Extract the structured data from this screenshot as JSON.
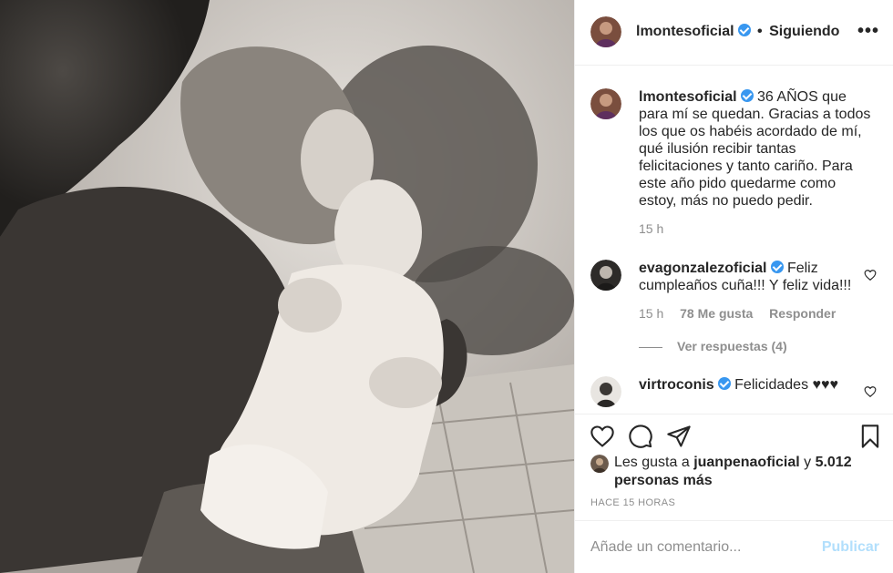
{
  "post": {
    "author": "lmontesoficial",
    "follow_status": "Siguiendo",
    "separator": "•",
    "more_glyph": "•••"
  },
  "caption": {
    "user": "lmontesoficial",
    "text": "36 AÑOS que para mí se quedan. Gracias a todos los que os habéis acordado de mí, qué ilusión recibir tantas felicitaciones y tanto cariño. Para este año pido quedarme como estoy, más no puedo pedir.",
    "time": "15 h"
  },
  "comments": [
    {
      "user": "evagonzalezoficial",
      "text": "Feliz cumpleaños cuña!!! Y feliz vida!!!",
      "time": "15 h",
      "likes": "78 Me gusta",
      "reply": "Responder",
      "view_replies": "Ver respuestas (4)"
    },
    {
      "user": "virtroconis",
      "text": "Felicidades ♥♥♥"
    }
  ],
  "likes": {
    "prefix": "Les gusta a",
    "user": "juanpenaoficial",
    "joiner": "y",
    "rest": "5.012 personas más"
  },
  "timestamp": "HACE 15 HORAS",
  "add_comment": {
    "placeholder": "Añade un comentario...",
    "publish": "Publicar"
  },
  "colors": {
    "verified": "#3897f0",
    "publish_disabled": "#b2dffc",
    "muted": "#8e8e8e"
  },
  "icons": [
    "heart-icon",
    "comment-icon",
    "share-icon",
    "bookmark-icon",
    "verified-badge-icon",
    "more-options-icon"
  ]
}
